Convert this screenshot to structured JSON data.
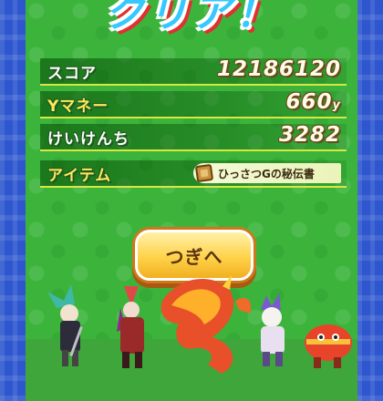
{
  "title": "クリア！",
  "stats": [
    {
      "label": "スコア",
      "value": "12186120",
      "unit": "",
      "label_color": "#ffffff"
    },
    {
      "label": "Yマネー",
      "value": "660",
      "unit": "y",
      "label_color": "#ffe85a"
    },
    {
      "label": "けいけんち",
      "value": "3282",
      "unit": "",
      "label_color": "#ffffff"
    }
  ],
  "item": {
    "label": "アイテム",
    "name": "ひっさつGの秘伝書",
    "icon": "scroll-icon"
  },
  "next_button": {
    "label": "つぎへ"
  },
  "characters": [
    "green-haired-swordsman",
    "red-armored-samurai",
    "fire-dragon",
    "purple-haired-fighter",
    "red-lantern-creature"
  ],
  "colors": {
    "panel_green": "#3cb43c",
    "side_blue": "#2e57cf",
    "button_gold": "#ffd24a",
    "title_cyan": "#37c8ff"
  }
}
